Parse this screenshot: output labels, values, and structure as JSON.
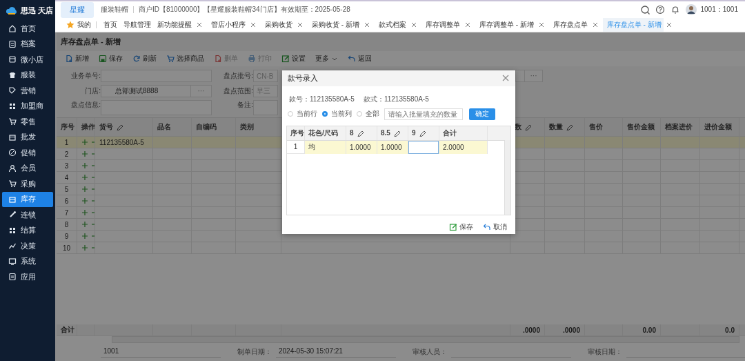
{
  "sidebar": {
    "logo": "思迅 天店",
    "items": [
      {
        "label": "首页",
        "selected": false
      },
      {
        "label": "档案",
        "selected": false
      },
      {
        "label": "微小店",
        "selected": false
      },
      {
        "label": "服装",
        "selected": false
      },
      {
        "label": "营销",
        "selected": false
      },
      {
        "label": "加盟商",
        "selected": false
      },
      {
        "label": "零售",
        "selected": false
      },
      {
        "label": "批发",
        "selected": false
      },
      {
        "label": "促销",
        "selected": false
      },
      {
        "label": "会员",
        "selected": false
      },
      {
        "label": "采购",
        "selected": false
      },
      {
        "label": "库存",
        "selected": true
      },
      {
        "label": "连锁",
        "selected": false
      },
      {
        "label": "结算",
        "selected": false
      },
      {
        "label": "决策",
        "selected": false
      },
      {
        "label": "系统",
        "selected": false
      },
      {
        "label": "应用",
        "selected": false
      }
    ]
  },
  "topbar": {
    "brand_tab": "星耀",
    "industry": "服装鞋帽",
    "merchant_info": "商户ID【81000000】【星耀服装鞋帽34门店】有效期至：2025-05-28",
    "user": "1001：1001"
  },
  "tabs": [
    {
      "label": "我的",
      "kind": "favorite",
      "selected": false
    },
    {
      "label": "首页",
      "kind": "fixed",
      "selected": false
    },
    {
      "label": "导航管理",
      "kind": "fixed",
      "selected": false
    },
    {
      "label": "新功能提醒",
      "kind": "closable",
      "selected": false
    },
    {
      "label": "管店小程序",
      "kind": "closable",
      "selected": false
    },
    {
      "label": "采购收货",
      "kind": "closable",
      "selected": false
    },
    {
      "label": "采购收货 - 新增",
      "kind": "closable",
      "selected": false
    },
    {
      "label": "款式档案",
      "kind": "closable",
      "selected": false
    },
    {
      "label": "库存调整单",
      "kind": "closable",
      "selected": false
    },
    {
      "label": "库存调整单 - 新增",
      "kind": "closable",
      "selected": false
    },
    {
      "label": "库存盘点单",
      "kind": "closable",
      "selected": false
    },
    {
      "label": "库存盘点单 - 新增",
      "kind": "closable",
      "selected": true
    }
  ],
  "page": {
    "title": "库存盘点单 - 新增",
    "toolbar": [
      {
        "label": "新增",
        "kind": "button",
        "disabled": false
      },
      {
        "label": "保存",
        "kind": "button",
        "disabled": false
      },
      {
        "label": "刷新",
        "kind": "button",
        "disabled": false
      },
      {
        "label": "选择商品",
        "kind": "button",
        "disabled": false
      },
      {
        "label": "删单",
        "kind": "button",
        "disabled": true
      },
      {
        "label": "打印",
        "kind": "button",
        "disabled": true
      },
      {
        "label": "设置",
        "kind": "button",
        "disabled": false
      },
      {
        "label": "更多",
        "kind": "dropdown",
        "disabled": false
      },
      {
        "label": "返回",
        "kind": "button",
        "disabled": false
      }
    ],
    "form": [
      [
        {
          "label": "业务单号:",
          "kind": "text"
        },
        {
          "label": "门店:",
          "kind": "lookup",
          "value": "总部测试8888",
          "button": "···"
        },
        {
          "label": "盘点信息:",
          "kind": "area"
        }
      ],
      [
        {
          "label": "盘点批号:",
          "kind": "text",
          "placeholder": "CN-B"
        },
        {
          "label": "盘点范围:",
          "kind": "text",
          "placeholder": "早三"
        },
        {
          "label": "备注:",
          "kind": "area"
        }
      ],
      [
        {
          "kind": "lookup",
          "button": "···"
        }
      ]
    ],
    "table": {
      "columns": [
        {
          "label": "序号",
          "editable": false,
          "total": "合计"
        },
        {
          "label": "操作",
          "editable": false
        },
        {
          "label": "货号",
          "editable": true
        },
        {
          "label": "品名",
          "editable": false
        },
        {
          "label": "自编码",
          "editable": false
        },
        {
          "label": "类别",
          "editable": false
        },
        {},
        {
          "label": "数",
          "editable": true,
          "total": ".0000"
        },
        {
          "label": "数量",
          "editable": true,
          "total": ".0000"
        },
        {
          "label": "售价",
          "editable": false
        },
        {
          "label": "售价金额",
          "editable": false,
          "total": "0.00"
        },
        {
          "label": "档案进价",
          "editable": false
        },
        {
          "label": "进价金额",
          "editable": false,
          "total": "0.0"
        }
      ],
      "rows": [
        {
          "index": "1",
          "sku": "112135580A-5",
          "selected": true
        },
        {
          "index": "2",
          "selected": false
        },
        {
          "index": "3",
          "selected": false
        },
        {
          "index": "4",
          "selected": false
        },
        {
          "index": "5",
          "selected": false
        },
        {
          "index": "6",
          "selected": false
        },
        {
          "index": "7",
          "selected": false
        },
        {
          "index": "8",
          "selected": false
        },
        {
          "index": "9",
          "selected": false
        },
        {
          "index": "10",
          "selected": false
        }
      ]
    },
    "footer_fields": [
      {
        "value": "1001"
      },
      {
        "label": "制单日期：",
        "value": "2024-05-30 15:07:21"
      },
      {
        "label": "审核人员："
      },
      {
        "label": "审核日期："
      }
    ]
  },
  "dialog": {
    "title": "款号录入",
    "style_no": "款号：112135580A-5",
    "style": "款式：112135580A-5",
    "fill_scope": [
      {
        "label": "当前行",
        "selected": false
      },
      {
        "label": "当前列",
        "selected": true
      },
      {
        "label": "全部",
        "selected": false
      }
    ],
    "fill_placeholder": "请输入批量填充的数量",
    "confirm": "确定",
    "columns": [
      {
        "label": "序号",
        "editable": false
      },
      {
        "label": "花色/尺码",
        "editable": false
      },
      {
        "label": "8",
        "editable": true
      },
      {
        "label": "8.5",
        "editable": true
      },
      {
        "label": "9",
        "editable": true
      },
      {
        "label": "合计",
        "editable": false
      }
    ],
    "rows": [
      {
        "index": "1",
        "color_size": "均",
        "quantities": [
          {
            "value": "1.0000"
          },
          {
            "value": "1.0000"
          },
          {
            "editing": true
          }
        ],
        "total": "2.0000"
      }
    ],
    "save": "保存",
    "cancel": "取消"
  }
}
